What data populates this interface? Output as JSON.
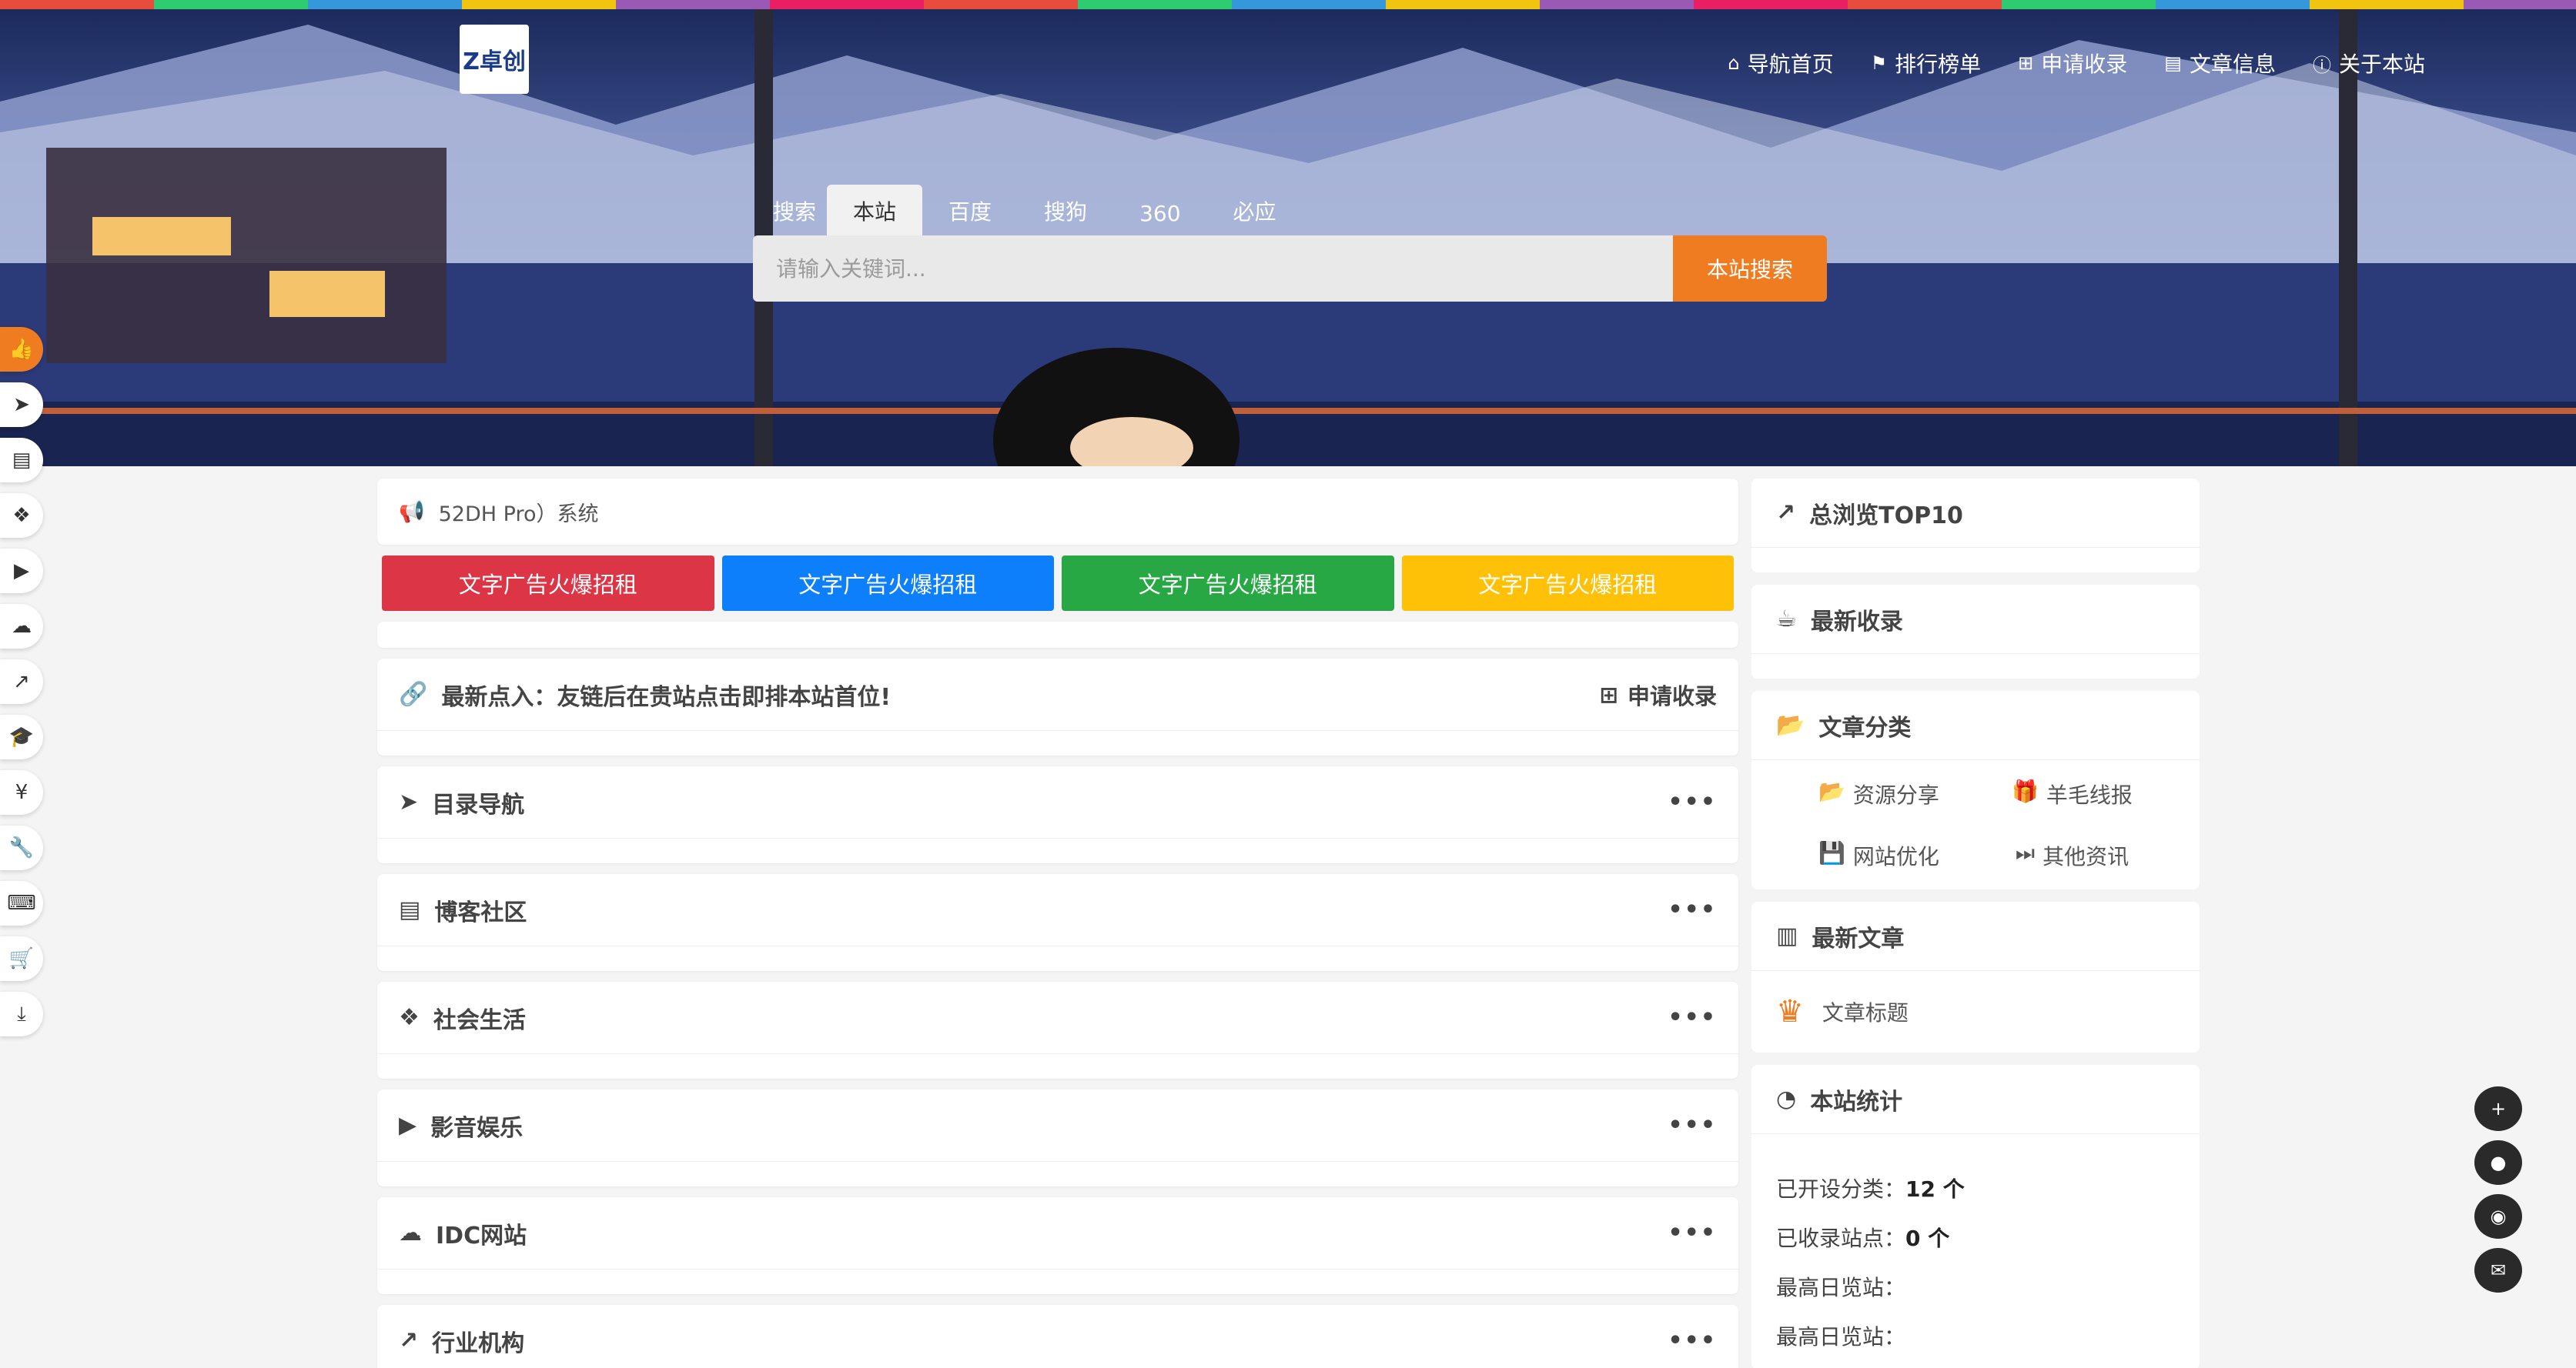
{
  "header": {
    "logo_text": "Z卓创",
    "nav": [
      {
        "icon": "home-icon",
        "glyph": "⌂",
        "label": "导航首页"
      },
      {
        "icon": "flag-icon",
        "glyph": "⚑",
        "label": "排行榜单"
      },
      {
        "icon": "plus-square-icon",
        "glyph": "⊞",
        "label": "申请收录"
      },
      {
        "icon": "book-icon",
        "glyph": "▤",
        "label": "文章信息"
      },
      {
        "icon": "info-icon",
        "glyph": "ⓘ",
        "label": "关于本站"
      }
    ]
  },
  "search": {
    "label": "搜索",
    "tabs": [
      "本站",
      "百度",
      "搜狗",
      "360",
      "必应"
    ],
    "active_tab": "本站",
    "placeholder": "请输入关键词...",
    "button": "本站搜索"
  },
  "left_sidebar": [
    {
      "icon": "thumbs-up-icon",
      "glyph": "👍",
      "active": true
    },
    {
      "icon": "paper-plane-icon",
      "glyph": "➤"
    },
    {
      "icon": "file-icon",
      "glyph": "▤"
    },
    {
      "icon": "cubes-icon",
      "glyph": "❖"
    },
    {
      "icon": "youtube-icon",
      "glyph": "▶"
    },
    {
      "icon": "cloud-icon",
      "glyph": "☁"
    },
    {
      "icon": "line-chart-icon",
      "glyph": "↗"
    },
    {
      "icon": "graduation-cap-icon",
      "glyph": "🎓"
    },
    {
      "icon": "yen-icon",
      "glyph": "¥"
    },
    {
      "icon": "wrench-icon",
      "glyph": "🔧"
    },
    {
      "icon": "keyboard-icon",
      "glyph": "⌨"
    },
    {
      "icon": "cart-icon",
      "glyph": "🛒"
    },
    {
      "icon": "download-icon",
      "glyph": "⤓"
    }
  ],
  "notice": {
    "text": "52DH Pro）系统"
  },
  "ads": [
    {
      "label": "文字广告火爆招租",
      "color": "#dc3545"
    },
    {
      "label": "文字广告火爆招租",
      "color": "#0d7ffb"
    },
    {
      "label": "文字广告火爆招租",
      "color": "#28a745"
    },
    {
      "label": "文字广告火爆招租",
      "color": "#ffc107"
    }
  ],
  "latest_in": {
    "text": "最新点入：友链后在贵站点击即排本站首位!",
    "apply": "申请收录"
  },
  "sections": [
    {
      "icon": "paper-plane-icon",
      "glyph": "➤",
      "title": "目录导航"
    },
    {
      "icon": "file-icon",
      "glyph": "▤",
      "title": "博客社区"
    },
    {
      "icon": "cubes-icon",
      "glyph": "❖",
      "title": "社会生活"
    },
    {
      "icon": "youtube-icon",
      "glyph": "▶",
      "title": "影音娱乐"
    },
    {
      "icon": "cloud-icon",
      "glyph": "☁",
      "title": "IDC网站"
    },
    {
      "icon": "line-chart-icon",
      "glyph": "↗",
      "title": "行业机构"
    }
  ],
  "more_glyph": "•••",
  "right": {
    "top10_title": "总浏览TOP10",
    "latest_title": "最新收录",
    "category_title": "文章分类",
    "categories": [
      {
        "icon": "folder-open-icon",
        "glyph": "📂",
        "label": "资源分享"
      },
      {
        "icon": "gift-icon",
        "glyph": "🎁",
        "label": "羊毛线报"
      },
      {
        "icon": "save-icon",
        "glyph": "💾",
        "label": "网站优化"
      },
      {
        "icon": "fast-forward-icon",
        "glyph": "⏭",
        "label": "其他资讯"
      }
    ],
    "articles_title": "最新文章",
    "article_item": "文章标题",
    "stats_title": "本站统计",
    "stats": [
      {
        "label": "已开设分类：",
        "value": "12 个"
      },
      {
        "label": "已收录站点：",
        "value": "0 个"
      },
      {
        "label": "最高日览站：",
        "value": ""
      },
      {
        "label": "最高日览站：",
        "value": ""
      }
    ]
  },
  "float_buttons": [
    {
      "icon": "plus-icon",
      "glyph": "+"
    },
    {
      "icon": "qq-icon",
      "glyph": "●"
    },
    {
      "icon": "wechat-icon",
      "glyph": "◉"
    },
    {
      "icon": "mail-icon",
      "glyph": "✉"
    }
  ]
}
